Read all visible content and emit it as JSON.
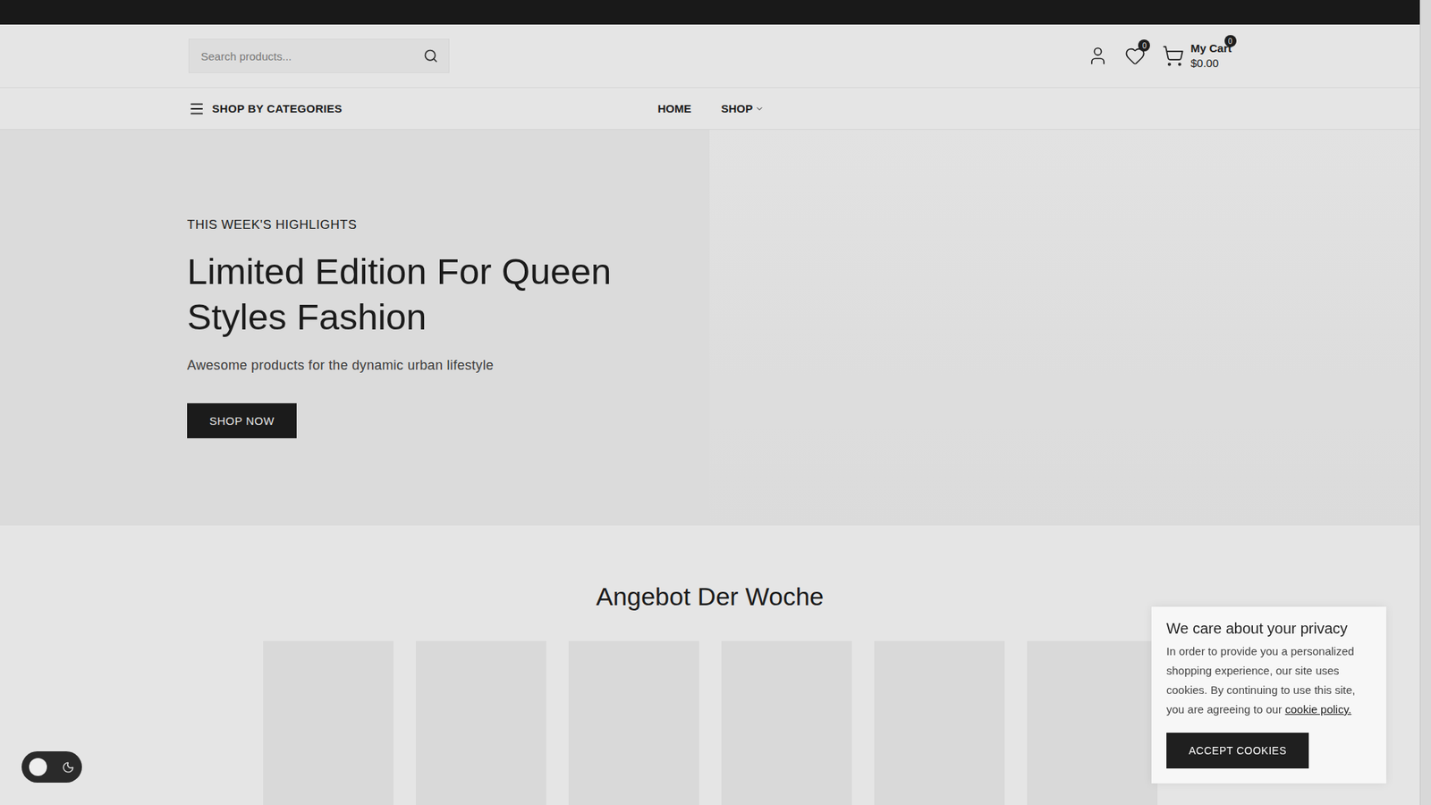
{
  "header": {
    "search": {
      "placeholder": "Search products..."
    },
    "wishlist": {
      "count": "0"
    },
    "cart": {
      "count": "0",
      "label": "My Cart",
      "total": "$0.00"
    }
  },
  "nav": {
    "categories": "SHOP BY CATEGORIES",
    "items": [
      {
        "label": "HOME",
        "selected": false,
        "has_dropdown": false
      },
      {
        "label": "SHOP",
        "selected": false,
        "has_dropdown": true
      }
    ]
  },
  "hero": {
    "eyebrow": "THIS WEEK'S HIGHLIGHTS",
    "title": "Limited Edition For Queen Styles Fashion",
    "subtitle": "Awesome products for the dynamic urban lifestyle",
    "button": "SHOP NOW"
  },
  "section": {
    "title": "Angebot Der Woche"
  },
  "cookie_notice": {
    "title": "We care about your privacy",
    "text": "In order to provide you a personalized shopping experience, our site uses cookies. By continuing to use this site, you are agreeing to our",
    "link": "cookie policy.",
    "button": "ACCEPT COOKIES"
  },
  "theme_toggle": {
    "dark": false
  }
}
